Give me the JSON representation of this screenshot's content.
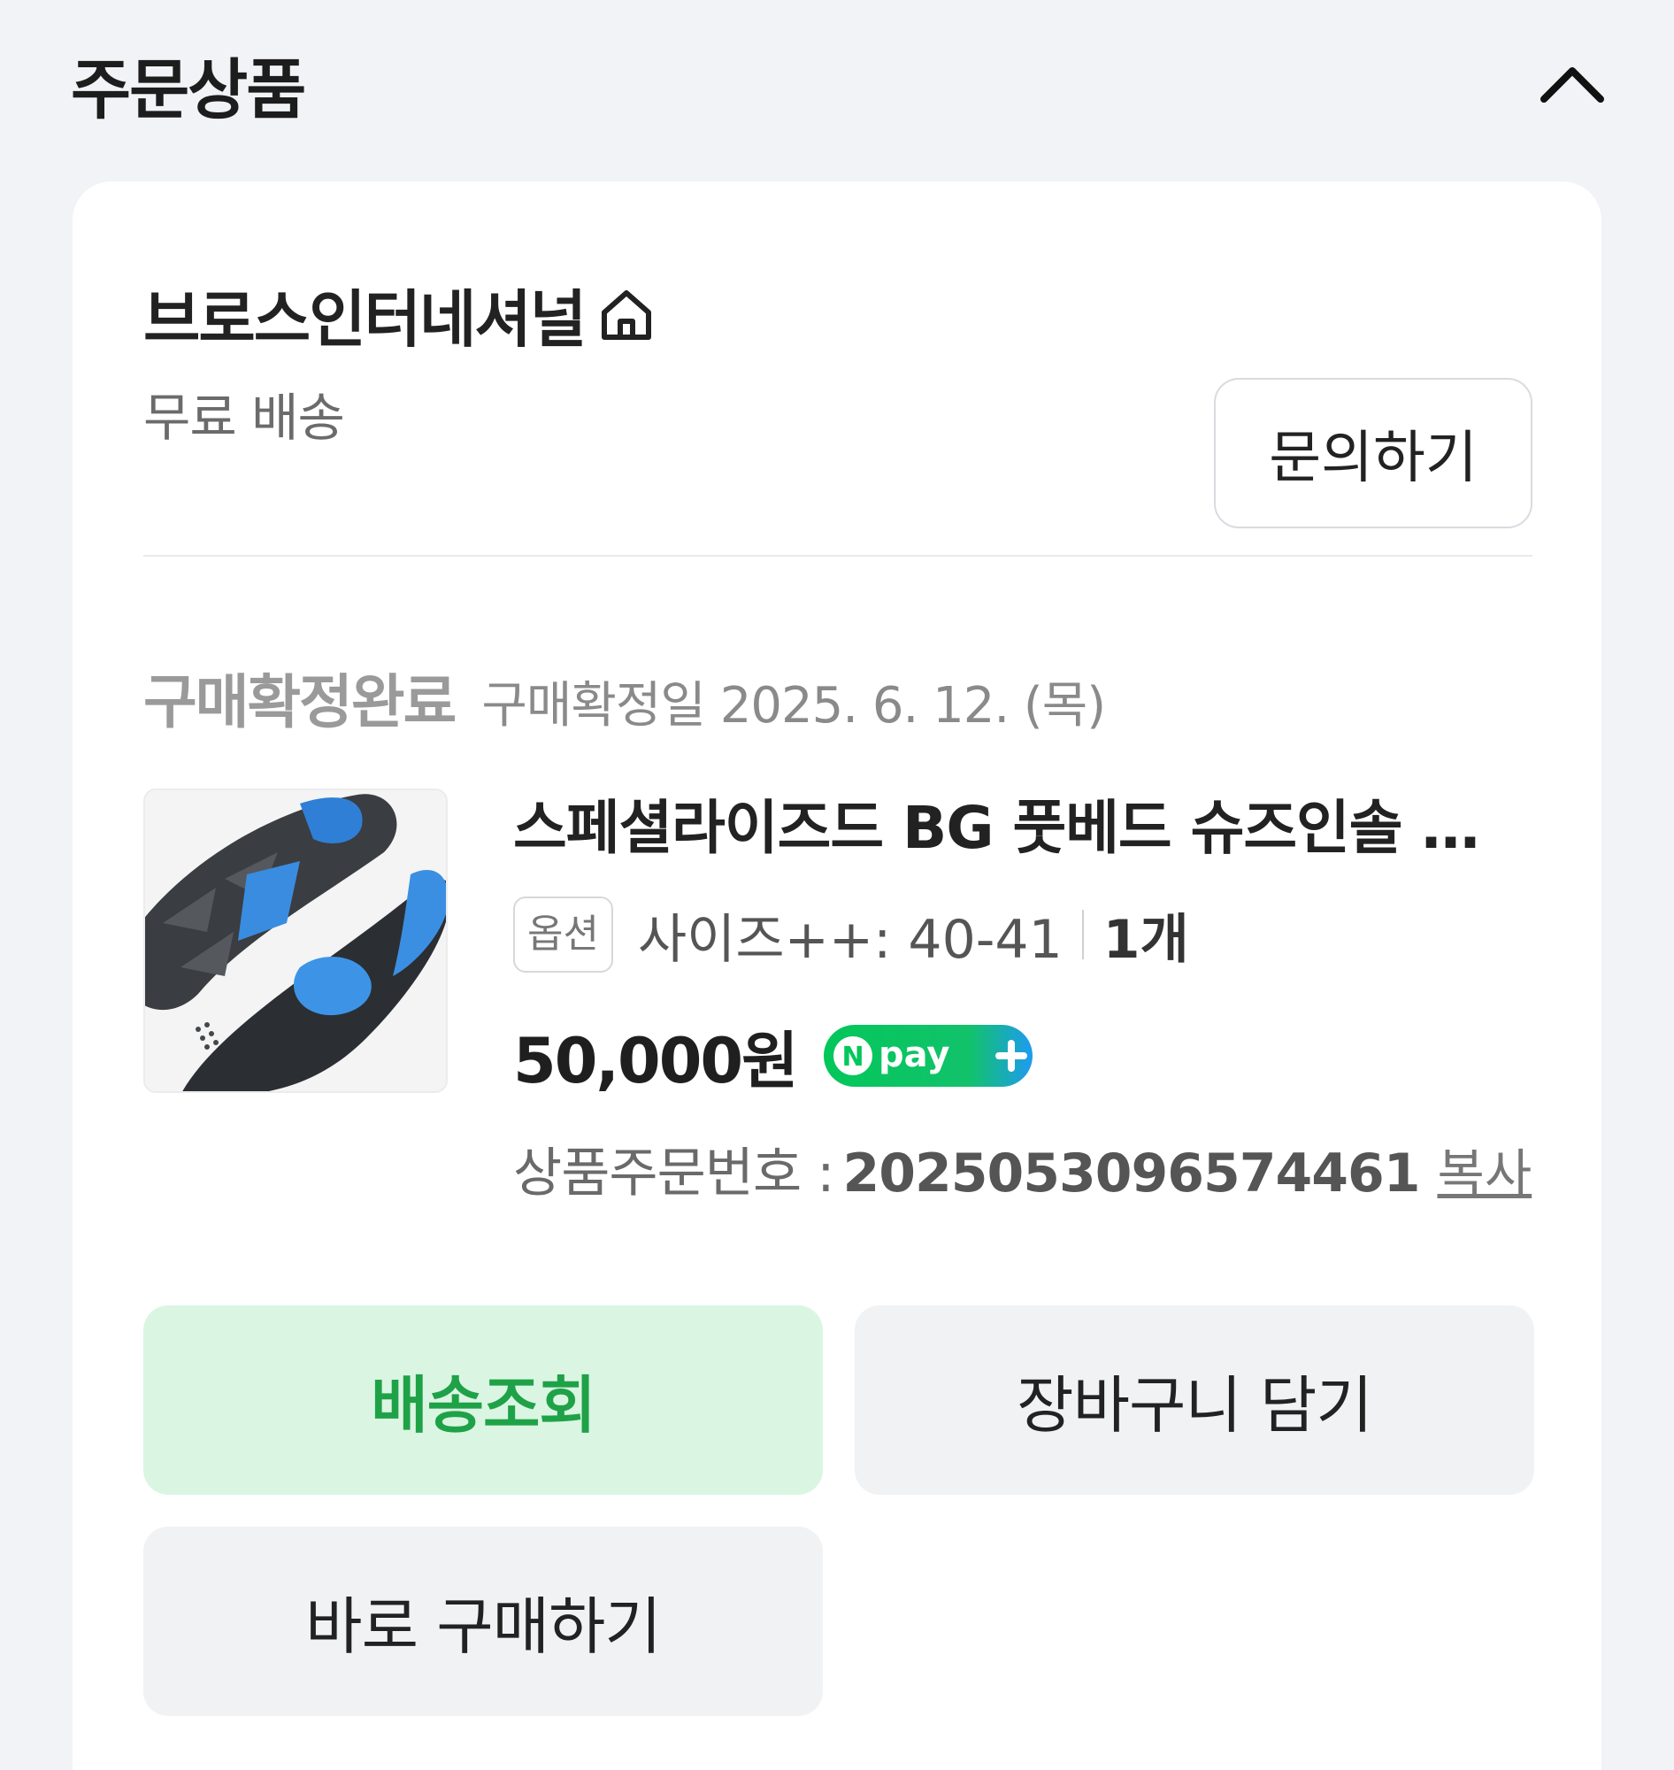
{
  "section": {
    "title": "주문상품",
    "collapse_icon": "chevron-up-icon"
  },
  "seller": {
    "name": "브로스인터네셔널",
    "home_icon": "home-icon",
    "shipping": "무료 배송",
    "inquiry_label": "문의하기"
  },
  "status": {
    "label": "구매확정완료",
    "date": "구매확정일 2025. 6. 12. (목)"
  },
  "product": {
    "name": "스페셜라이즈드 BG 풋베드 슈즈인솔 …",
    "option_badge": "옵션",
    "option_text": "사이즈++: 40-41",
    "quantity": "1개",
    "price": "50,000원",
    "npay_label": "pay",
    "order_label": "상품주문번호 :",
    "order_number": "2025053096574461",
    "copy_label": "복사"
  },
  "actions": {
    "track_label": "배송조회",
    "cart_label": "장바구니 담기",
    "buy_label": "바로 구매하기"
  },
  "colors": {
    "page_bg": "#f1f3f6",
    "card_bg": "#ffffff",
    "track_bg": "#dbf5e3",
    "track_text": "#1fa247",
    "secondary_bg": "#f1f2f4",
    "npay_green": "#03c75a",
    "npay_blue": "#1e9bf0"
  }
}
